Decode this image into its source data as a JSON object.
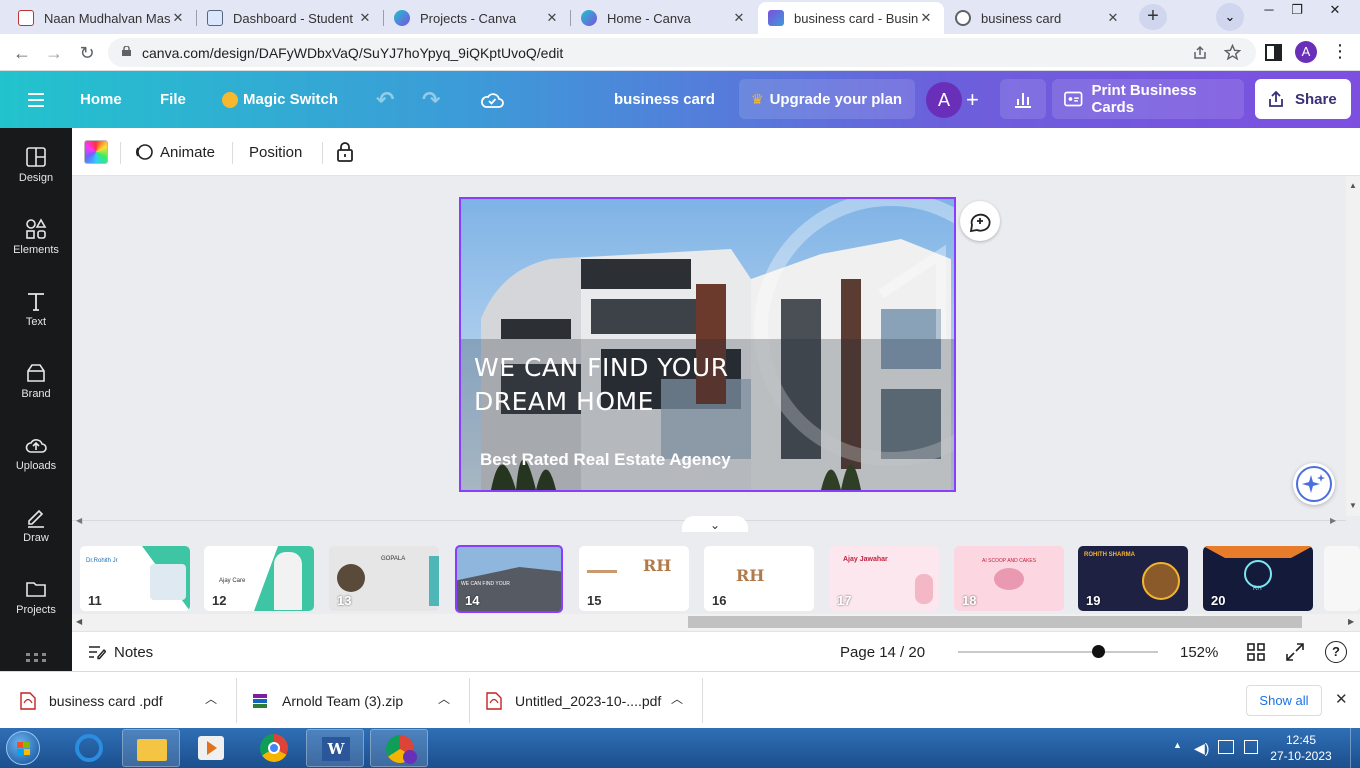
{
  "browser": {
    "tabs": [
      {
        "label": "Naan Mudhalvan Mass",
        "icon": "naan-mudhalvan-favicon"
      },
      {
        "label": "Dashboard - Student",
        "icon": "dashboard-favicon"
      },
      {
        "label": "Projects - Canva",
        "icon": "canva-favicon"
      },
      {
        "label": "Home - Canva",
        "icon": "canva-favicon"
      },
      {
        "label": "business card - Busines",
        "icon": "canva-design-favicon",
        "active": true
      },
      {
        "label": "business card",
        "icon": "globe-favicon"
      }
    ],
    "close_glyph": "✕",
    "new_tab_glyph": "+",
    "url": "canva.com/design/DAFyWDbxVaQ/SuYJ7hoYpyq_9iQKptUvoQ/edit",
    "profile_initial": "A"
  },
  "canva_header": {
    "home": "Home",
    "file": "File",
    "magic_switch": "Magic Switch",
    "doc_title": "business card",
    "upgrade": "Upgrade your plan",
    "avatar_initial": "A",
    "print": "Print Business Cards",
    "share": "Share"
  },
  "sidebar": {
    "items": [
      {
        "label": "Design",
        "icon": "design-icon"
      },
      {
        "label": "Elements",
        "icon": "elements-icon"
      },
      {
        "label": "Text",
        "icon": "text-icon"
      },
      {
        "label": "Brand",
        "icon": "brand-icon"
      },
      {
        "label": "Uploads",
        "icon": "uploads-icon"
      },
      {
        "label": "Draw",
        "icon": "draw-icon"
      },
      {
        "label": "Projects",
        "icon": "projects-icon"
      }
    ]
  },
  "toolbar": {
    "animate": "Animate",
    "position": "Position"
  },
  "design": {
    "headline_line1": "WE CAN FIND YOUR",
    "headline_line2": "DREAM HOME",
    "tagline": "Best Rated Real Estate Agency"
  },
  "filmstrip": {
    "pages": [
      {
        "num": "11",
        "bg": "#ffffff",
        "label": "Dr.Rohith Jr"
      },
      {
        "num": "12",
        "bg": "#ffffff",
        "label": "Ajay Care"
      },
      {
        "num": "13",
        "bg": "#e6e6e6",
        "label": "GOPALA"
      },
      {
        "num": "14",
        "bg": "#8fb6dd",
        "label": "WE CAN FIND YOUR",
        "selected": true
      },
      {
        "num": "15",
        "bg": "#ffffff",
        "label": "RH"
      },
      {
        "num": "16",
        "bg": "#ffffff",
        "label": "RH"
      },
      {
        "num": "17",
        "bg": "#fde7ee",
        "label": "Ajay Jawahar"
      },
      {
        "num": "18",
        "bg": "#fcd7e1",
        "label": "AI SCOOP AND CAKES"
      },
      {
        "num": "19",
        "bg": "#1f2143",
        "label": "ROHITH SHARMA"
      },
      {
        "num": "20",
        "bg": "#141a3a",
        "label": "RH"
      }
    ]
  },
  "statusbar": {
    "notes": "Notes",
    "page": "Page 14 / 20",
    "zoom": "152%",
    "zoom_level_fraction": 0.7
  },
  "downloads": {
    "items": [
      {
        "name": "business card .pdf",
        "icon": "pdf-file-icon"
      },
      {
        "name": "Arnold Team (3).zip",
        "icon": "zip-file-icon"
      },
      {
        "name": "Untitled_2023-10-....pdf",
        "icon": "pdf-file-icon"
      }
    ],
    "show_all": "Show all"
  },
  "taskbar": {
    "time": "12:45",
    "date": "27-10-2023"
  },
  "colors": {
    "accent": "#8b3dff",
    "header_start": "#22c3cd",
    "header_end": "#7d4fe0",
    "sidebar_bg": "#18191b"
  }
}
